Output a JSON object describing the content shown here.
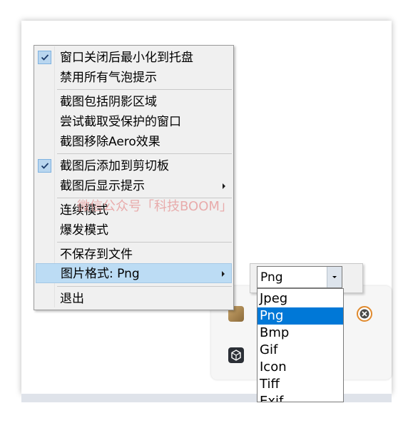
{
  "menu": {
    "items": [
      {
        "label": "窗口关闭后最小化到托盘",
        "checked": true
      },
      {
        "label": "禁用所有气泡提示",
        "checked": false
      },
      {
        "label": "截图包括阴影区域",
        "checked": false
      },
      {
        "label": "尝试截取受保护的窗口",
        "checked": false
      },
      {
        "label": "截图移除Aero效果",
        "checked": false
      },
      {
        "label": "截图后添加到剪切板",
        "checked": true
      },
      {
        "label": "截图后显示提示",
        "checked": false,
        "has_submenu": true
      },
      {
        "label": "连续模式",
        "checked": false
      },
      {
        "label": "爆发模式",
        "checked": false
      },
      {
        "label": "不保存到文件",
        "checked": false
      },
      {
        "label": "图片格式: Png",
        "checked": false,
        "has_submenu": true,
        "highlighted": true
      },
      {
        "label": "退出",
        "checked": false
      }
    ]
  },
  "format_combo": {
    "selected_value": "Png",
    "options": [
      "Jpeg",
      "Png",
      "Bmp",
      "Gif",
      "Icon",
      "Tiff",
      "Exif"
    ],
    "highlighted_option": "Png"
  },
  "watermark": {
    "text": "微信公众号「科技BOOM」"
  },
  "icons": {
    "check": "checkmark-icon",
    "submenu": "chevron-right-icon",
    "dropdown": "caret-down-icon",
    "tray_app_1": "app-icon",
    "tray_app_2": "cube-app-icon",
    "tray_close": "close-circle-icon"
  },
  "colors": {
    "menu_bg": "#f0f0f0",
    "menu_highlight": "#bcdcf4",
    "selected_option": "#0078d7",
    "watermark": "#e79a9a",
    "close_icon": "#e08a2e"
  }
}
